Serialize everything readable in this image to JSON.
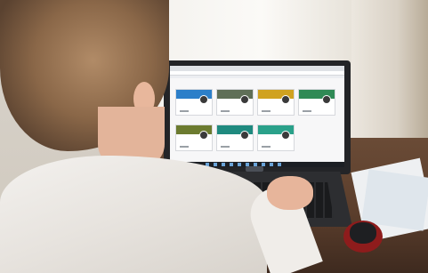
{
  "scene": {
    "description_free": true,
    "colors": {
      "screen_background": "#f7f7f8",
      "laptop_body": "#232427",
      "table_wood": "#5b3e2c"
    }
  },
  "screen": {
    "cards": [
      {
        "color": "#2c7fc9"
      },
      {
        "color": "#5f6f57"
      },
      {
        "color": "#d0a21f"
      },
      {
        "color": "#2f8a55"
      },
      {
        "color": "#6c7b2f"
      },
      {
        "color": "#1f8a7f"
      },
      {
        "color": "#2aa18a"
      }
    ],
    "taskbar_icons": 10
  }
}
